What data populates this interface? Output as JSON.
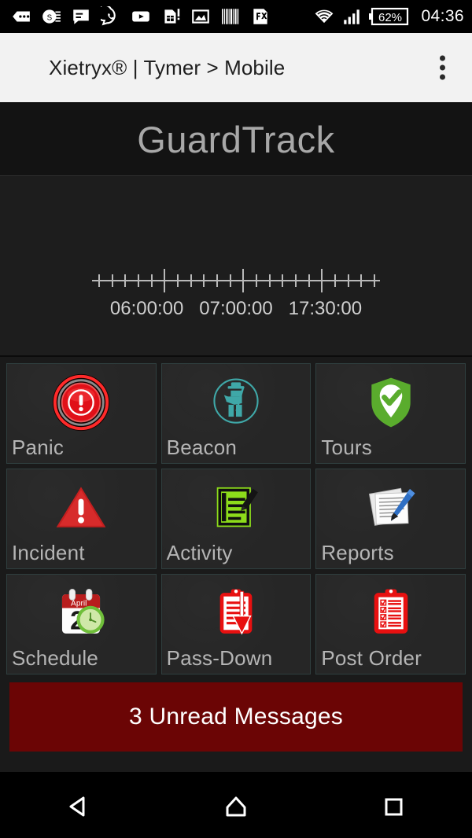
{
  "status_bar": {
    "time": "04:36",
    "battery_percent": "62%",
    "notification_icons": [
      "more-dots-icon",
      "news-app-icon",
      "message-icon",
      "whatsapp-icon",
      "youtube-icon",
      "sim-alert-icon",
      "photo-icon",
      "barcode-icon",
      "fx-app-icon"
    ],
    "system_icons": [
      "wifi-icon",
      "cellular-signal-icon",
      "battery-icon"
    ]
  },
  "title_bar": {
    "title": "Xietryx® | Tymer > Mobile",
    "overflow_menu": "overflow-menu"
  },
  "app_header": {
    "title": "GuardTrack"
  },
  "timeline": {
    "power_button": "power-toggle",
    "play_button": "play-shift",
    "labels": [
      {
        "text": "06:00:00",
        "position_pct": 23
      },
      {
        "text": "07:00:00",
        "position_pct": 50
      },
      {
        "text": "17:30:00",
        "position_pct": 77
      }
    ],
    "ticks": {
      "count": 22,
      "major_indices": [
        5,
        11,
        17
      ]
    },
    "accent_play_color": "#3ba7ef",
    "panel_bg": "#1d1d1d"
  },
  "grid": {
    "tiles": [
      {
        "label": "Panic",
        "icon": "panic-button-icon",
        "color": "#e8111b"
      },
      {
        "label": "Beacon",
        "icon": "beacon-guard-icon",
        "color": "#3fa8a8"
      },
      {
        "label": "Tours",
        "icon": "shield-check-icon",
        "color": "#5aac2d"
      },
      {
        "label": "Incident",
        "icon": "warning-triangle-icon",
        "color": "#cc2222"
      },
      {
        "label": "Activity",
        "icon": "notepad-pencil-icon",
        "color": "#8ddc1b"
      },
      {
        "label": "Reports",
        "icon": "papers-pen-icon",
        "color": "#2f6fc4"
      },
      {
        "label": "Schedule",
        "icon": "calendar-clock-icon",
        "color": "#b81d1d"
      },
      {
        "label": "Pass-Down",
        "icon": "clipboard-down-arrow-icon",
        "color": "#e81010"
      },
      {
        "label": "Post Order",
        "icon": "clipboard-checklist-icon",
        "color": "#e81010"
      }
    ]
  },
  "messages_banner": {
    "text": "3 Unread Messages",
    "color": "#6b0505"
  },
  "nav_bar": {
    "buttons": [
      "back-button",
      "home-button",
      "recents-button"
    ]
  }
}
